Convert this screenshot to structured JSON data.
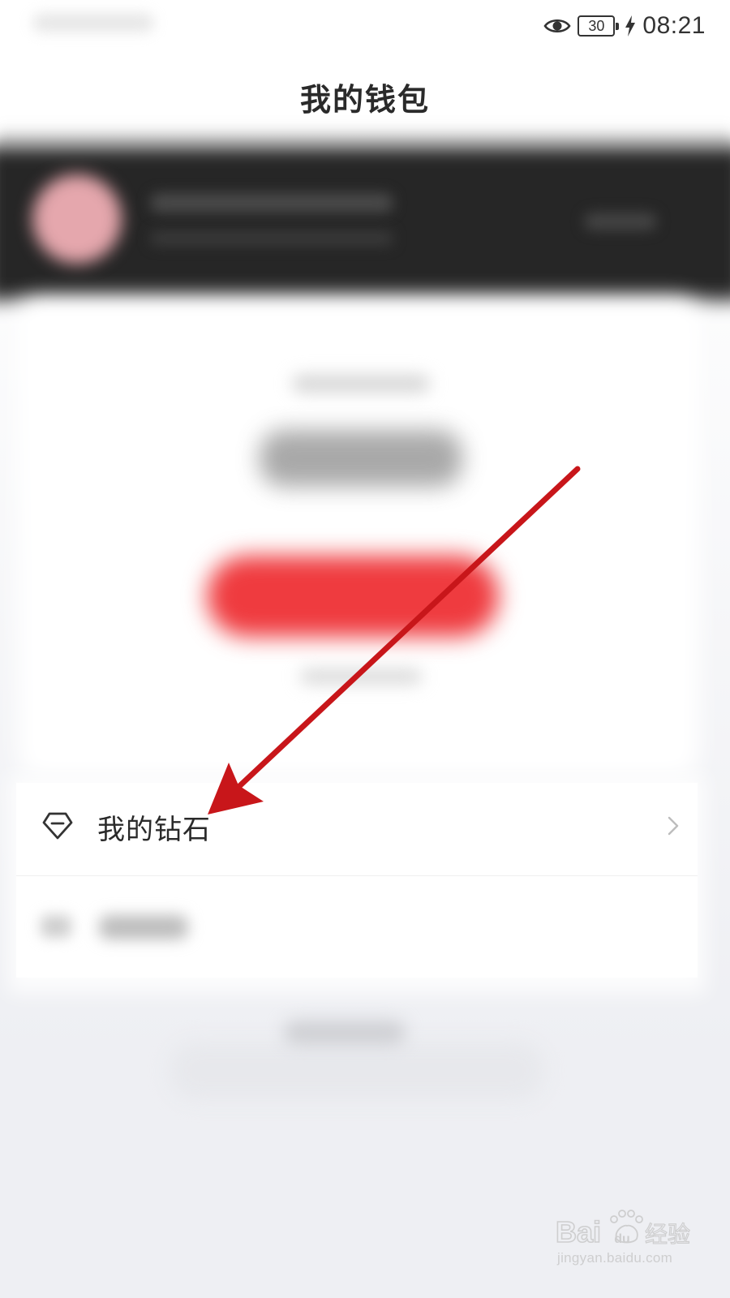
{
  "status_bar": {
    "battery_level": "30",
    "time": "08:21",
    "icons": [
      "eye-icon",
      "battery-icon",
      "charging-bolt-icon"
    ]
  },
  "header": {
    "title": "我的钱包"
  },
  "list": {
    "items": [
      {
        "label": "我的钻石",
        "icon": "diamond-icon",
        "trailing_icon": "chevron-right-icon"
      }
    ]
  },
  "watermark": {
    "logo_text": "Baidu经验",
    "url": "jingyan.baidu.com"
  },
  "colors": {
    "annotation_arrow": "#c8161a",
    "recharge_button": "#ef3b3f",
    "profile_band": "#262626",
    "page_background": "#eeeff3"
  }
}
